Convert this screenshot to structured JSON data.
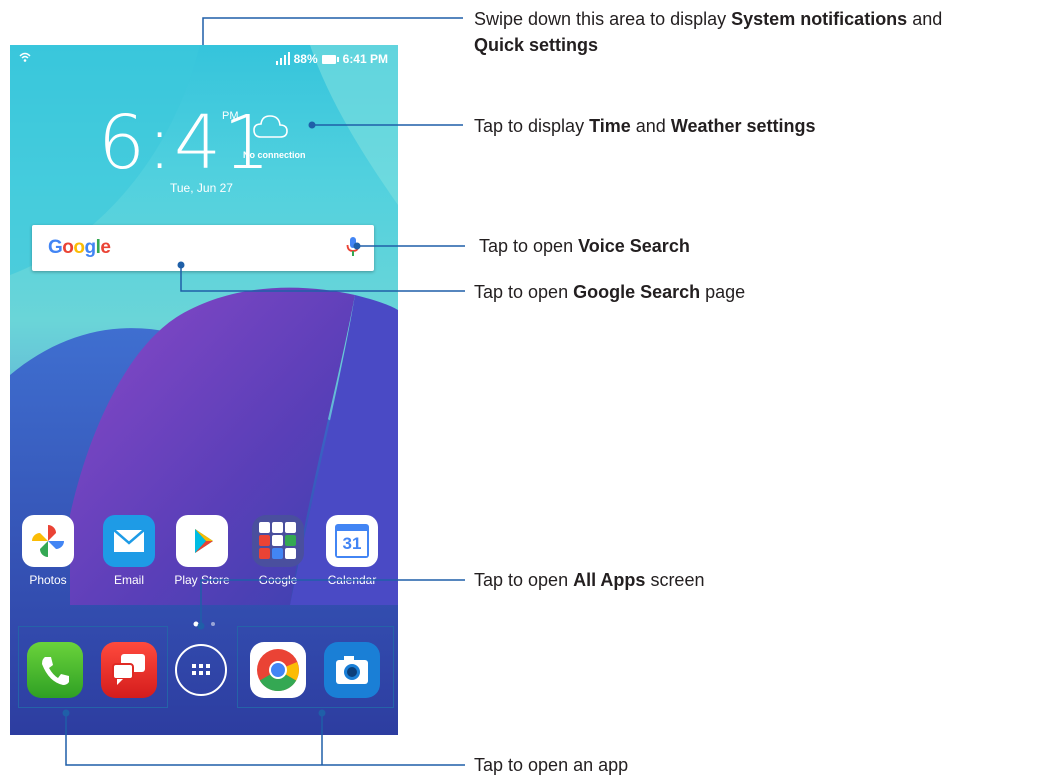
{
  "status_bar": {
    "battery": "88%",
    "time": "6:41 PM"
  },
  "clock": {
    "time": "6:41",
    "ampm": "PM",
    "date": "Tue, Jun 27"
  },
  "weather": {
    "status": "No connection",
    "icon": "cloud-icon"
  },
  "search": {
    "logo": "Google",
    "mic_icon": "mic-icon"
  },
  "apps": [
    {
      "label": "Photos",
      "icon": "photos-pinwheel-icon"
    },
    {
      "label": "Email",
      "icon": "envelope-icon"
    },
    {
      "label": "Play Store",
      "icon": "play-store-icon"
    },
    {
      "label": "Google",
      "icon": "google-folder-icon"
    },
    {
      "label": "Calendar",
      "icon": "calendar-icon",
      "day": "31"
    }
  ],
  "dock": [
    {
      "name": "phone",
      "icon": "phone-handset-icon"
    },
    {
      "name": "messaging",
      "icon": "chat-bubbles-icon"
    },
    {
      "name": "all-apps",
      "icon": "app-drawer-icon"
    },
    {
      "name": "chrome",
      "icon": "chrome-icon"
    },
    {
      "name": "camera",
      "icon": "camera-icon"
    }
  ],
  "annotations": {
    "notifications": {
      "pre": "Swipe down this area to display ",
      "b1": "System notifications",
      "mid": " and",
      "b2": "Quick settings"
    },
    "time_weather": {
      "pre": "Tap to display ",
      "b1": "Time",
      "mid": " and ",
      "b2": "Weather settings"
    },
    "voice": {
      "pre": "Tap to open ",
      "b1": "Voice Search"
    },
    "google": {
      "pre": "Tap to open ",
      "b1": "Google Search",
      "post": " page"
    },
    "all_apps": {
      "pre": "Tap to open ",
      "b1": "All Apps",
      "post": " screen"
    },
    "open_app": {
      "text": "Tap to open an app"
    }
  },
  "colors": {
    "callout_line": "#1f5fa8",
    "text": "#231f20"
  }
}
